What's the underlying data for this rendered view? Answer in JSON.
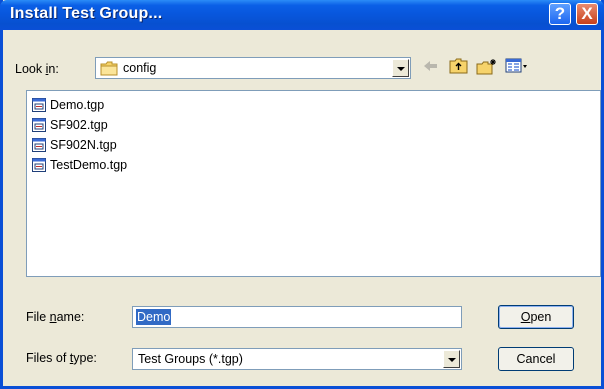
{
  "window": {
    "title": "Install Test Group...",
    "help_button": "?",
    "close_button": "X"
  },
  "look_in": {
    "label_pre": "Look ",
    "label_accel": "i",
    "label_post": "n:",
    "value": "config",
    "folder_icon": "folder-icon"
  },
  "toolbar": {
    "icons": [
      "back-arrow-icon",
      "up-folder-icon",
      "new-folder-icon",
      "view-menu-icon"
    ]
  },
  "files": [
    {
      "name": "Demo.tgp",
      "icon": "tgp-file-icon"
    },
    {
      "name": "SF902.tgp",
      "icon": "tgp-file-icon"
    },
    {
      "name": "SF902N.tgp",
      "icon": "tgp-file-icon"
    },
    {
      "name": "TestDemo.tgp",
      "icon": "tgp-file-icon"
    }
  ],
  "file_name": {
    "label_pre": "File ",
    "label_accel": "n",
    "label_post": "ame:",
    "value": "Demo"
  },
  "file_type": {
    "label_pre": "Files of ",
    "label_accel": "t",
    "label_post": "ype:",
    "value": "Test Groups (*.tgp)"
  },
  "buttons": {
    "open_accel": "O",
    "open_rest": "pen",
    "cancel": "Cancel"
  },
  "colors": {
    "titlebar": "#0a5fe6",
    "selection": "#316ac5",
    "dialog_bg": "#ece9d8"
  }
}
